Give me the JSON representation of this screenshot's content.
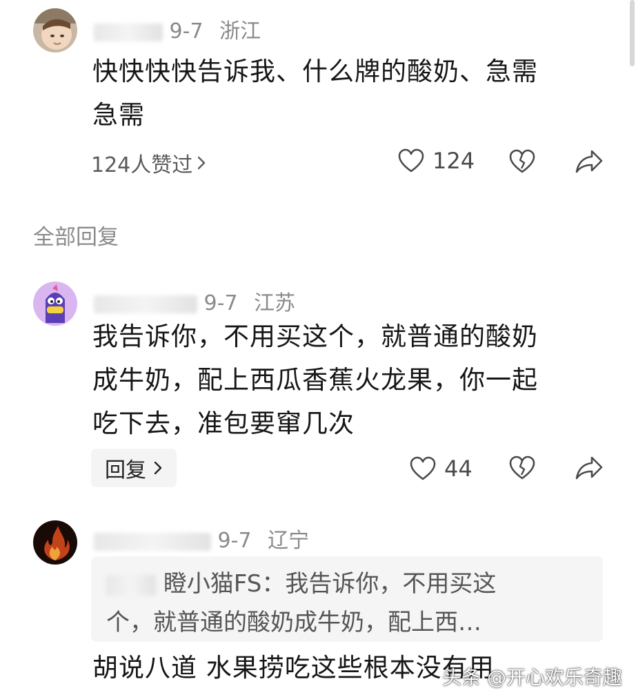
{
  "comment": {
    "meta_date": "9-7",
    "meta_location": "浙江",
    "text_line1": "快快快快告诉我、什么牌的酸奶、急需",
    "text_line2": "急需",
    "likes_link": "124人赞过",
    "like_count": "124"
  },
  "section": {
    "title": "全部回复"
  },
  "replies": [
    {
      "meta_date": "9-7",
      "meta_location": "江苏",
      "text_line1": "我告诉你，不用买这个，就普通的酸奶",
      "text_line2": "成牛奶，配上西瓜香蕉火龙果，你一起",
      "text_line3": "吃下去，准包要窜几次",
      "reply_label": "回复",
      "like_count": "44"
    },
    {
      "meta_date": "9-7",
      "meta_location": "辽宁",
      "quote_name_visible": "瞪小猫FS",
      "quote_line1": "：我告诉你，不用买这",
      "quote_line2": "个，就普通的酸奶成牛奶，配上西…",
      "text_line1": "胡说八道 水果捞吃这些根本没有用"
    }
  ],
  "watermark": "头条 @开心欢乐奇趣",
  "colors": {
    "text": "#161616",
    "meta": "#8a8a8a",
    "panel": "#f4f4f4",
    "accent": "#ffffff"
  }
}
